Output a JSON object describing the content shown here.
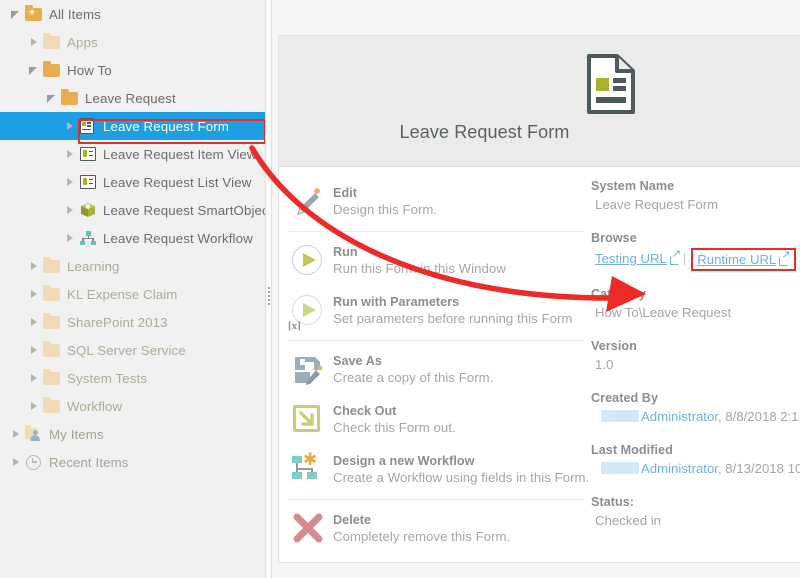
{
  "tree": {
    "items": [
      {
        "label": "All Items",
        "icon": "folder-star-icon",
        "indent": 0,
        "twisty": "expanded",
        "state": "normal"
      },
      {
        "label": "Apps",
        "icon": "folder-icon",
        "indent": 1,
        "twisty": "collapsed",
        "state": "dim"
      },
      {
        "label": "How To",
        "icon": "folder-icon",
        "indent": 1,
        "twisty": "expanded",
        "state": "normal"
      },
      {
        "label": "Leave Request",
        "icon": "folder-icon",
        "indent": 2,
        "twisty": "expanded",
        "state": "normal"
      },
      {
        "label": "Leave Request Form",
        "icon": "form-icon",
        "indent": 3,
        "twisty": "collapsed",
        "state": "selected"
      },
      {
        "label": "Leave Request Item View",
        "icon": "view-icon",
        "indent": 3,
        "twisty": "collapsed",
        "state": "normal"
      },
      {
        "label": "Leave Request List View",
        "icon": "view-icon",
        "indent": 3,
        "twisty": "collapsed",
        "state": "normal"
      },
      {
        "label": "Leave Request SmartObject",
        "icon": "smartobject-icon",
        "indent": 3,
        "twisty": "collapsed",
        "state": "normal"
      },
      {
        "label": "Leave Request Workflow",
        "icon": "workflow-icon",
        "indent": 3,
        "twisty": "collapsed",
        "state": "normal"
      },
      {
        "label": "Learning",
        "icon": "folder-icon",
        "indent": 1,
        "twisty": "collapsed",
        "state": "dim"
      },
      {
        "label": "KL Expense Claim",
        "icon": "folder-icon",
        "indent": 1,
        "twisty": "collapsed",
        "state": "dim"
      },
      {
        "label": "SharePoint 2013",
        "icon": "folder-icon",
        "indent": 1,
        "twisty": "collapsed",
        "state": "dim"
      },
      {
        "label": "SQL Server Service",
        "icon": "folder-icon",
        "indent": 1,
        "twisty": "collapsed",
        "state": "dim"
      },
      {
        "label": "System Tests",
        "icon": "folder-icon",
        "indent": 1,
        "twisty": "collapsed",
        "state": "dim"
      },
      {
        "label": "Workflow",
        "icon": "folder-icon",
        "indent": 1,
        "twisty": "collapsed",
        "state": "dim"
      },
      {
        "label": "My Items",
        "icon": "my-items-icon",
        "indent": 0,
        "twisty": "collapsed",
        "state": "dim2"
      },
      {
        "label": "Recent Items",
        "icon": "recent-items-icon",
        "indent": 0,
        "twisty": "collapsed",
        "state": "dim2"
      }
    ]
  },
  "hero": {
    "title": "Leave Request Form",
    "icon": "form-document-icon"
  },
  "actions": [
    {
      "title": "Edit",
      "desc": "Design this Form.",
      "icon": "pencil-icon",
      "divider_after": true
    },
    {
      "title": "Run",
      "desc": "Run this Form in this Window",
      "icon": "play-circle-icon",
      "divider_after": false
    },
    {
      "title": "Run with Parameters",
      "desc": "Set parameters before running this Form",
      "icon": "play-params-icon",
      "divider_after": true
    },
    {
      "title": "Save As",
      "desc": "Create a copy of this Form.",
      "icon": "save-as-icon",
      "divider_after": false
    },
    {
      "title": "Check Out",
      "desc": "Check this Form out.",
      "icon": "check-out-icon",
      "divider_after": false
    },
    {
      "title": "Design a new Workflow",
      "desc": "Create a Workflow using fields in this Form.",
      "icon": "design-workflow-icon",
      "divider_after": true
    },
    {
      "title": "Delete",
      "desc": "Completely remove this Form.",
      "icon": "delete-x-icon",
      "divider_after": false
    }
  ],
  "properties": {
    "system_name": {
      "label": "System Name",
      "value": "Leave Request Form"
    },
    "browse": {
      "label": "Browse",
      "testing_url": "Testing URL",
      "separator": "|",
      "runtime_url": "Runtime URL"
    },
    "category": {
      "label": "Category",
      "value": "How To\\Leave Request"
    },
    "version": {
      "label": "Version",
      "value": "1.0"
    },
    "created_by": {
      "label": "Created By",
      "user": "Administrator",
      "meta": ", 8/8/2018 2:1"
    },
    "last_modified": {
      "label": "Last Modified",
      "user": "Administrator",
      "meta": ", 8/13/2018 10"
    },
    "status": {
      "label": "Status:",
      "value": "Checked in"
    }
  },
  "annotation": {
    "color": "#ec2b26",
    "highlight_selected_tree_item": "Leave Request Form",
    "highlight_target": "Runtime URL",
    "arrow_description": "red curved arrow from selected tree item to Runtime URL link"
  }
}
